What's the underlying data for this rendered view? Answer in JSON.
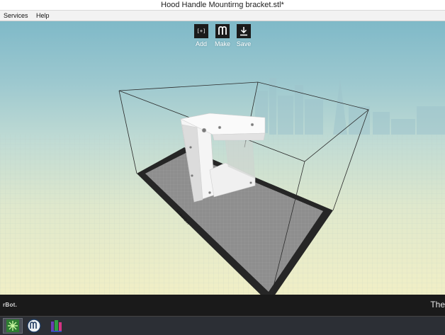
{
  "window": {
    "title": "Hood Handle Mountirng bracket.stl*"
  },
  "menu": {
    "items": [
      "Services",
      "Help"
    ]
  },
  "toolbar": {
    "add_label": "Add",
    "make_label": "Make",
    "save_label": "Save",
    "add_icon_text": "[+]"
  },
  "platform": {
    "logo_text": "MakerBot"
  },
  "statusbar": {
    "brand": "rBot.",
    "right_text": "The"
  },
  "taskbar": {
    "items": [
      "start-icon",
      "makerware-icon",
      "app-icon"
    ]
  },
  "colors": {
    "accent": "#1b1b1b",
    "model": "#f4f4f4",
    "build_plate": "#8a8a8a"
  }
}
